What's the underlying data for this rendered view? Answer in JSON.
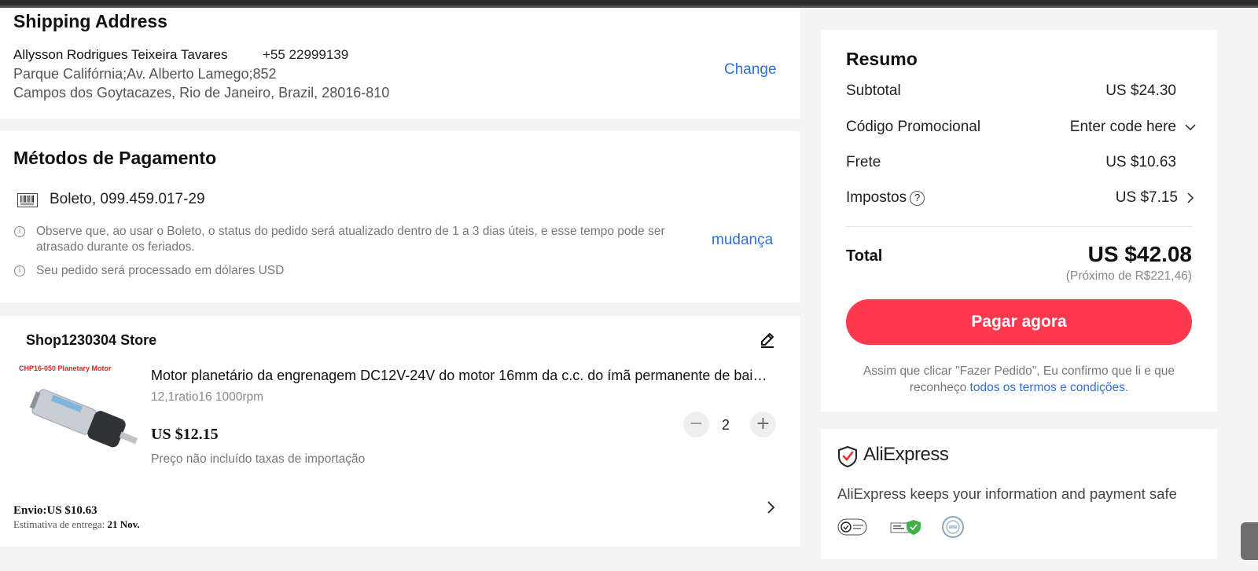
{
  "address": {
    "title": "Shipping Address",
    "name": "Allysson Rodrigues Teixeira Tavares",
    "phone": "+55 22999139",
    "line1": "Parque Califórnia;Av. Alberto Lamego;852",
    "line2": "Campos dos Goytacazes, Rio de Janeiro, Brazil, 28016-810",
    "change_label": "Change"
  },
  "payment": {
    "title": "Métodos de Pagamento",
    "method": "Boleto, 099.459.017-29",
    "note1": "Observe que, ao usar o Boleto, o status do pedido será atualizado dentro de 1 a 3 dias úteis, e esse tempo pode ser atrasado durante os feriados.",
    "note2": "Seu pedido será processado em dólares USD",
    "change_label": "mudança"
  },
  "shop": {
    "name": "Shop1230304 Store",
    "product": {
      "image_label": "CHP16-050 Planetary Motor",
      "title": "Motor planetário da engrenagem DC12V-24V do motor 16mm da c.c. do ímã permanente de baixa velocidade",
      "variant": "12,1ratio16 1000rpm",
      "price": "US $12.15",
      "note": "Preço não incluído taxas de importação",
      "quantity": "2"
    },
    "shipping_label": "Envio:US $10.63",
    "eta_label": "Estimativa de entrega:",
    "eta_value": "21 Nov."
  },
  "summary": {
    "title": "Resumo",
    "subtotal_label": "Subtotal",
    "subtotal_value": "US $24.30",
    "promo_label": "Código Promocional",
    "promo_value": "Enter code here",
    "shipping_label": "Frete",
    "shipping_value": "US $10.63",
    "taxes_label": "Impostos",
    "taxes_value": "US $7.15",
    "total_label": "Total",
    "total_value": "US $42.08",
    "total_approx": "(Próximo de R$221,46)",
    "pay_button": "Pagar agora",
    "terms_text": "Assim que clicar \"Fazer Pedido\", Eu confirmo que li e que reconheço",
    "terms_link": "todos os termos e condições",
    "terms_end": "."
  },
  "safety": {
    "brand": "AliExpress",
    "text": "AliExpress keeps your information and payment safe"
  },
  "colors": {
    "accent": "#fd384f",
    "link": "#2f6fd8"
  }
}
